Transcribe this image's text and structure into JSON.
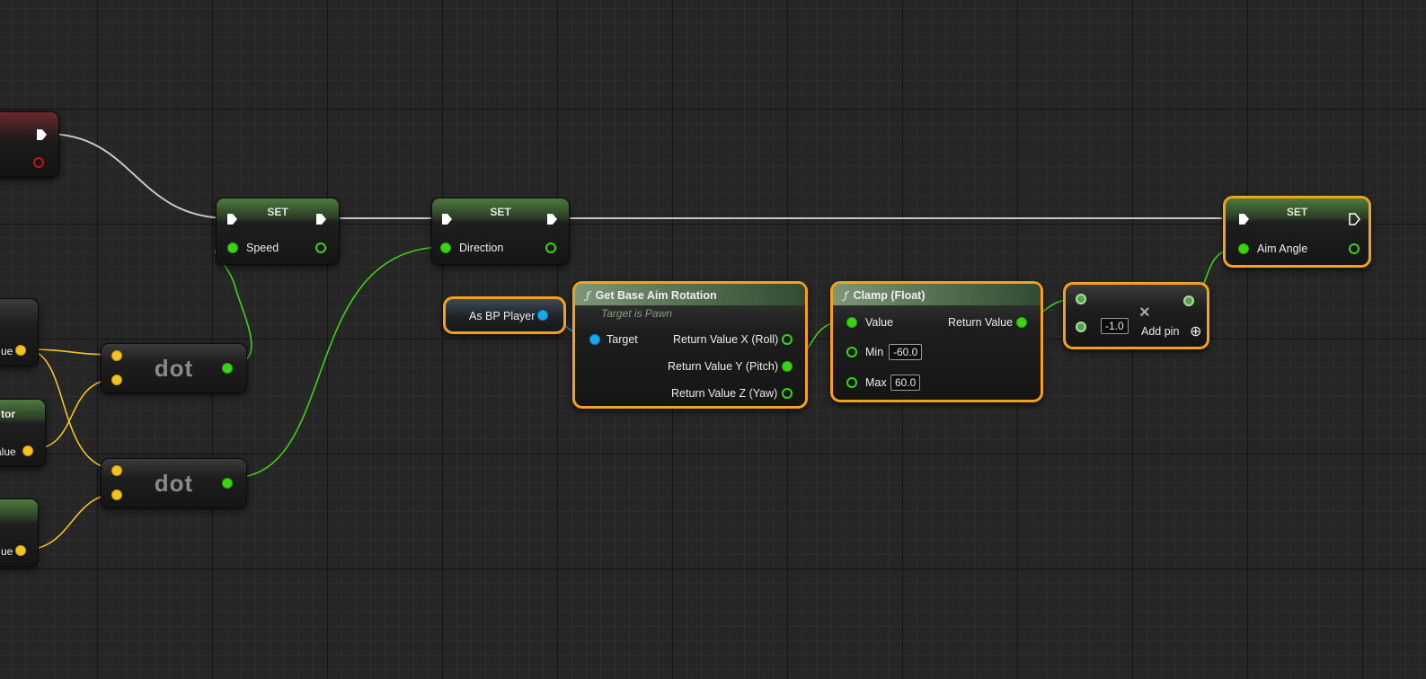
{
  "nodes": {
    "set_speed": {
      "title": "SET",
      "var": "Speed"
    },
    "set_direction": {
      "title": "SET",
      "var": "Direction"
    },
    "set_aim_angle": {
      "title": "SET",
      "var": "Aim Angle"
    },
    "as_bp_player": {
      "label": "As BP Player"
    },
    "get_base_aim": {
      "title": "Get Base Aim Rotation",
      "subtitle": "Target is Pawn",
      "target": "Target",
      "out_roll": "Return Value X (Roll)",
      "out_pitch": "Return Value Y (Pitch)",
      "out_yaw": "Return Value Z (Yaw)"
    },
    "clamp": {
      "title": "Clamp (Float)",
      "value": "Value",
      "return_value": "Return Value",
      "min_label": "Min",
      "min_value": "-60.0",
      "max_label": "Max",
      "max_value": "60.0"
    },
    "multiply": {
      "operator": "×",
      "value": "-1.0",
      "add_pin": "Add pin",
      "add_pin_icon": "⊕"
    },
    "dot1": {
      "title": "dot"
    },
    "dot2": {
      "title": "dot"
    },
    "left_clipped": {
      "label_a": "ue",
      "label_b": "tor",
      "label_c": "alue",
      "label_d": "ue"
    }
  },
  "colors": {
    "selection": "#f7a11b",
    "float_pin": "#3ad413",
    "vector_pin": "#f5c320",
    "object_pin": "#1ba7f1",
    "exec_wire": "#c8c8c8"
  },
  "icons": {
    "function": "ƒ",
    "multiply": "×",
    "add_pin": "⊕"
  }
}
